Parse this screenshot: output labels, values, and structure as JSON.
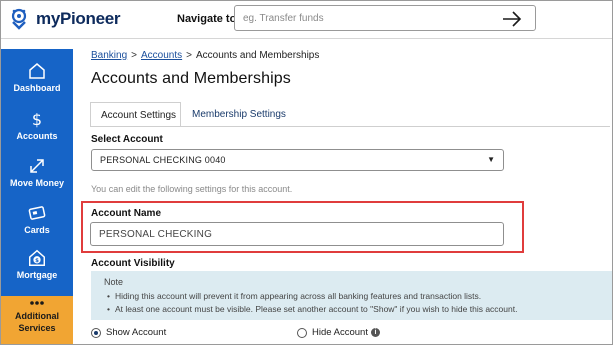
{
  "brand": {
    "name": "myPioneer"
  },
  "header": {
    "navigate_label": "Navigate to",
    "search_placeholder": "eg. Transfer funds"
  },
  "sidebar": {
    "items": [
      {
        "label": "Dashboard",
        "icon": "home-icon"
      },
      {
        "label": "Accounts",
        "icon": "dollar-icon"
      },
      {
        "label": "Move Money",
        "icon": "arrows-diagonal-icon"
      },
      {
        "label": "Cards",
        "icon": "card-icon"
      },
      {
        "label": "Mortgage",
        "icon": "house-dollar-icon"
      },
      {
        "label": "Additional Services",
        "icon": "more-dots-icon",
        "line1": "Additional",
        "line2": "Services"
      }
    ],
    "colors": {
      "background": "#1664c7",
      "active": "#f1a533"
    }
  },
  "breadcrumb": {
    "items": [
      "Banking",
      "Accounts",
      "Accounts and Memberships"
    ],
    "separator": ">"
  },
  "page": {
    "title": "Accounts and Memberships"
  },
  "tabs": [
    {
      "label": "Account Settings",
      "active": true
    },
    {
      "label": "Membership Settings",
      "active": false
    }
  ],
  "account_select": {
    "label": "Select Account",
    "selected": "PERSONAL CHECKING 0040"
  },
  "hint": "You can edit the following settings for this account.",
  "account_name": {
    "label": "Account Name",
    "value": "PERSONAL CHECKING",
    "highlight_color": "#e03c3c"
  },
  "visibility": {
    "label": "Account Visibility",
    "note_title": "Note",
    "note_lines": [
      "Hiding this account will prevent it from appearing across all banking features and transaction lists.",
      "At least one account must be visible. Please set another account to \"Show\" if you wish to hide this account."
    ],
    "options": [
      {
        "label": "Show Account",
        "checked": true
      },
      {
        "label": "Hide Account",
        "checked": false
      }
    ]
  }
}
